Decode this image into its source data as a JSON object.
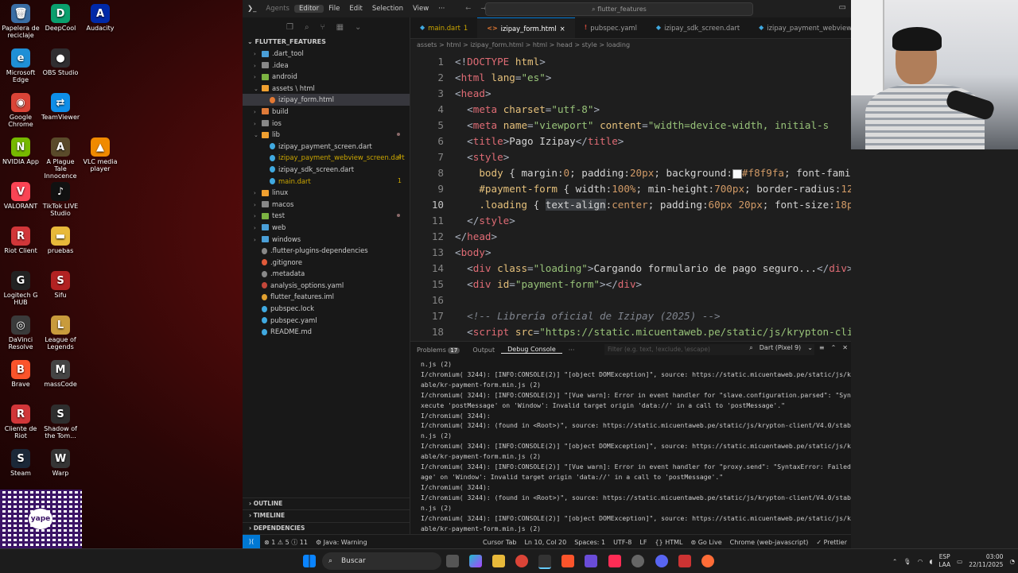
{
  "desktop": {
    "icons": [
      {
        "label": "Papelera de reciclaje",
        "glyph": "🗑",
        "color": "#3a6ea5"
      },
      {
        "label": "Microsoft Edge",
        "glyph": "e",
        "color": "#1f8fd6"
      },
      {
        "label": "Google Chrome",
        "glyph": "◉",
        "color": "#db4437"
      },
      {
        "label": "NVIDIA App",
        "glyph": "N",
        "color": "#76b900"
      },
      {
        "label": "VALORANT",
        "glyph": "V",
        "color": "#fa4454"
      },
      {
        "label": "Riot Client",
        "glyph": "R",
        "color": "#d13639"
      },
      {
        "label": "Logitech G HUB",
        "glyph": "G",
        "color": "#222222"
      },
      {
        "label": "DaVinci Resolve",
        "glyph": "◎",
        "color": "#3a3a3a"
      },
      {
        "label": "Brave",
        "glyph": "B",
        "color": "#fb542b"
      },
      {
        "label": "Cliente de Riot",
        "glyph": "R",
        "color": "#d13639"
      },
      {
        "label": "Steam",
        "glyph": "S",
        "color": "#1b2838"
      },
      {
        "label": "DeepCool",
        "glyph": "D",
        "color": "#0aa06e"
      },
      {
        "label": "OBS Studio",
        "glyph": "●",
        "color": "#302e31"
      },
      {
        "label": "TeamViewer",
        "glyph": "⇄",
        "color": "#0e8ee9"
      },
      {
        "label": "A Plague Tale Innocence",
        "glyph": "A",
        "color": "#5a4a2a"
      },
      {
        "label": "TikTok LIVE Studio",
        "glyph": "♪",
        "color": "#111111"
      },
      {
        "label": "pruebas",
        "glyph": "▬",
        "color": "#e8b93a"
      },
      {
        "label": "Sifu",
        "glyph": "S",
        "color": "#b22222"
      },
      {
        "label": "League of Legends",
        "glyph": "L",
        "color": "#c89b3c"
      },
      {
        "label": "massCode",
        "glyph": "M",
        "color": "#444444"
      },
      {
        "label": "Shadow of the Tom...",
        "glyph": "S",
        "color": "#2e2e2e"
      },
      {
        "label": "Warp",
        "glyph": "W",
        "color": "#353535"
      },
      {
        "label": "Audacity",
        "glyph": "A",
        "color": "#0029a8"
      },
      {
        "label": "VLC media player",
        "glyph": "▲",
        "color": "#f08a00"
      }
    ],
    "qr_label": "yape"
  },
  "titlebar": {
    "items": [
      "Agents",
      "Editor",
      "File",
      "Edit",
      "Selection",
      "View",
      "···"
    ],
    "search": "flutter_features"
  },
  "sidebar": {
    "title": "FLUTTER_FEATURES",
    "tree": [
      {
        "label": ".dart_tool",
        "depth": 1,
        "folder": true,
        "open": false,
        "color": "#4a9fd8"
      },
      {
        "label": ".idea",
        "depth": 1,
        "folder": true,
        "open": false,
        "color": "#888888"
      },
      {
        "label": "android",
        "depth": 1,
        "folder": true,
        "open": false,
        "color": "#7cb342"
      },
      {
        "label": "assets \\ html",
        "depth": 1,
        "folder": true,
        "open": true,
        "color": "#f0a030"
      },
      {
        "label": "izipay_form.html",
        "depth": 2,
        "folder": false,
        "color": "#e37933",
        "selected": true
      },
      {
        "label": "build",
        "depth": 1,
        "folder": true,
        "open": false,
        "color": "#e07b39"
      },
      {
        "label": "ios",
        "depth": 1,
        "folder": true,
        "open": false,
        "color": "#888888"
      },
      {
        "label": "lib",
        "depth": 1,
        "folder": true,
        "open": true,
        "color": "#f0a030",
        "mod": true
      },
      {
        "label": "izipay_payment_screen.dart",
        "depth": 2,
        "folder": false,
        "color": "#40a9e0"
      },
      {
        "label": "izipay_payment_webview_screen.dart",
        "depth": 2,
        "folder": false,
        "color": "#40a9e0",
        "badge": "4",
        "badgeColor": "#cca700"
      },
      {
        "label": "izipay_sdk_screen.dart",
        "depth": 2,
        "folder": false,
        "color": "#40a9e0"
      },
      {
        "label": "main.dart",
        "depth": 2,
        "folder": false,
        "color": "#40a9e0",
        "badge": "1",
        "badgeColor": "#cca700"
      },
      {
        "label": "linux",
        "depth": 1,
        "folder": true,
        "open": false,
        "color": "#f0a030"
      },
      {
        "label": "macos",
        "depth": 1,
        "folder": true,
        "open": false,
        "color": "#888888"
      },
      {
        "label": "test",
        "depth": 1,
        "folder": true,
        "open": false,
        "color": "#7cb342",
        "mod": true
      },
      {
        "label": "web",
        "depth": 1,
        "folder": true,
        "open": false,
        "color": "#4a9fd8"
      },
      {
        "label": "windows",
        "depth": 1,
        "folder": true,
        "open": false,
        "color": "#4a9fd8"
      },
      {
        "label": ".flutter-plugins-dependencies",
        "depth": 1,
        "folder": false,
        "color": "#888888"
      },
      {
        "label": ".gitignore",
        "depth": 1,
        "folder": false,
        "color": "#e05a3a"
      },
      {
        "label": ".metadata",
        "depth": 1,
        "folder": false,
        "color": "#888888"
      },
      {
        "label": "analysis_options.yaml",
        "depth": 1,
        "folder": false,
        "color": "#c4473a"
      },
      {
        "label": "flutter_features.iml",
        "depth": 1,
        "folder": false,
        "color": "#e0a030"
      },
      {
        "label": "pubspec.lock",
        "depth": 1,
        "folder": false,
        "color": "#40a9e0"
      },
      {
        "label": "pubspec.yaml",
        "depth": 1,
        "folder": false,
        "color": "#40a9e0"
      },
      {
        "label": "README.md",
        "depth": 1,
        "folder": false,
        "color": "#40a9e0"
      }
    ],
    "sections": [
      "OUTLINE",
      "TIMELINE",
      "DEPENDENCIES"
    ]
  },
  "tabs": [
    {
      "label": "main.dart",
      "suffix": "1",
      "icon": "◆",
      "iconColor": "#40a9e0",
      "active": false
    },
    {
      "label": "izipay_form.html",
      "suffix": "×",
      "icon": "<>",
      "iconColor": "#e37933",
      "active": true
    },
    {
      "label": "pubspec.yaml",
      "suffix": "",
      "icon": "!",
      "iconColor": "#c4473a",
      "active": false
    },
    {
      "label": "izipay_sdk_screen.dart",
      "suffix": "",
      "icon": "◆",
      "iconColor": "#40a9e0",
      "active": false
    },
    {
      "label": "izipay_payment_webview_scre",
      "suffix": "",
      "icon": "◆",
      "iconColor": "#40a9e0",
      "active": false
    }
  ],
  "breadcrumb": "assets > html > izipay_form.html > html > head > style > loading",
  "code": [
    "<span class='t-pun'>&lt;!</span><span class='t-tag'>DOCTYPE</span> <span class='t-attr'>html</span><span class='t-pun'>&gt;</span>",
    "<span class='t-pun'>&lt;</span><span class='t-tag'>html</span> <span class='t-attr'>lang</span><span class='t-pun'>=</span><span class='t-str'>\"es\"</span><span class='t-pun'>&gt;</span>",
    "<span class='t-pun'>&lt;</span><span class='t-tag'>head</span><span class='t-pun'>&gt;</span>",
    "  <span class='t-pun'>&lt;</span><span class='t-tag'>meta</span> <span class='t-attr'>charset</span><span class='t-pun'>=</span><span class='t-str'>\"utf-8\"</span><span class='t-pun'>&gt;</span>",
    "  <span class='t-pun'>&lt;</span><span class='t-tag'>meta</span> <span class='t-attr'>name</span><span class='t-pun'>=</span><span class='t-str'>\"viewport\"</span> <span class='t-attr'>content</span><span class='t-pun'>=</span><span class='t-str'>\"width=device-width, initial-s</span>",
    "  <span class='t-pun'>&lt;</span><span class='t-tag'>title</span><span class='t-pun'>&gt;</span><span class='t-txt'>Pago Izipay</span><span class='t-pun'>&lt;/</span><span class='t-tag'>title</span><span class='t-pun'>&gt;</span>",
    "  <span class='t-pun'>&lt;</span><span class='t-tag'>style</span><span class='t-pun'>&gt;</span>",
    "    <span class='t-sel'>body</span> { <span class='t-prop'>margin</span>:<span class='t-val'>0</span>; <span class='t-prop'>padding</span>:<span class='t-val'>20px</span>; <span class='t-prop'>background</span>:<span style='background:#f8f9fa;display:inline-block;width:10px;height:10px;border:1px solid #888;vertical-align:middle'></span><span class='t-val'>#f8f9fa</span>; <span class='t-prop'>font-family</span>:<span class='t-val'>system-ui,</span>",
    "    <span class='t-sel'>#payment-form</span> { <span class='t-prop'>width</span>:<span class='t-val'>100%</span>; <span class='t-prop'>min-height</span>:<span class='t-val'>700px</span>; <span class='t-prop'>border-radius</span>:<span class='t-val'>12px</span>; <span class='t-prop'>overflow</span>:<span class='t-val'>h</span>",
    "    <span class='t-sel'>.loading</span> { <span class='t-prop' style='background:#3a3d41'>text-align</span>:<span class='t-val'>center</span>; <span class='t-prop'>padding</span>:<span class='t-val'>60px 20px</span>; <span class='t-prop'>font-size</span>:<span class='t-val'>18px</span>; <span class='t-prop'>color</span>:<span style='background:#333;display:inline-block;width:10px;height:10px;border:1px solid #888;vertical-align:middle'></span><span class='t-val'>#33</span>",
    "  <span class='t-pun'>&lt;/</span><span class='t-tag'>style</span><span class='t-pun'>&gt;</span>",
    "<span class='t-pun'>&lt;/</span><span class='t-tag'>head</span><span class='t-pun'>&gt;</span>",
    "<span class='t-pun'>&lt;</span><span class='t-tag'>body</span><span class='t-pun'>&gt;</span>",
    "  <span class='t-pun'>&lt;</span><span class='t-tag'>div</span> <span class='t-attr'>class</span><span class='t-pun'>=</span><span class='t-str'>\"loading\"</span><span class='t-pun'>&gt;</span><span class='t-txt'>Cargando formulario de pago seguro...</span><span class='t-pun'>&lt;/</span><span class='t-tag'>div</span><span class='t-pun'>&gt;</span>",
    "  <span class='t-pun'>&lt;</span><span class='t-tag'>div</span> <span class='t-attr'>id</span><span class='t-pun'>=</span><span class='t-str'>\"payment-form\"</span><span class='t-pun'>&gt;&lt;/</span><span class='t-tag'>div</span><span class='t-pun'>&gt;</span>",
    "",
    "  <span class='t-com'>&lt;!-- Librería oficial de Izipay (2025) --&gt;</span>",
    "  <span class='t-pun'>&lt;</span><span class='t-tag'>script</span> <span class='t-attr'>src</span><span class='t-pun'>=</span><span class='t-str'>\"https://static.micuentaweb.pe/static/js/krypton-client/V4.0/stabl</span>"
  ],
  "current_line": 10,
  "panel": {
    "tabs": [
      "Problems",
      "Output",
      "Debug Console",
      "···"
    ],
    "problems_count": "17",
    "filter_placeholder": "Filter (e.g. text, !exclude, \\escape)",
    "device": "Dart (Pixel 9)",
    "console": [
      "n.js (2)",
      "I/chromium( 3244): [INFO:CONSOLE(2)] \"[object DOMException]\", source: https://static.micuentaweb.pe/static/js/krypton-client/V4.0/st",
      "able/kr-payment-form.min.js (2)",
      "I/chromium( 3244): [INFO:CONSOLE(2)] \"[Vue warn]: Error in event handler for \"slave.configuration.parsed\": \"SyntaxError: Failed to e",
      "xecute 'postMessage' on 'Window': Invalid target origin 'data://' in a call to 'postMessage'.\"",
      "I/chromium( 3244):",
      "I/chromium( 3244): (found in <Root>)\", source: https://static.micuentaweb.pe/static/js/krypton-client/V4.0/stable/kr-payment-form.mi",
      "n.js (2)",
      "I/chromium( 3244): [INFO:CONSOLE(2)] \"[object DOMException]\", source: https://static.micuentaweb.pe/static/js/krypton-client/V4.0/st",
      "able/kr-payment-form.min.js (2)",
      "I/chromium( 3244): [INFO:CONSOLE(2)] \"[Vue warn]: Error in event handler for \"proxy.send\": \"SyntaxError: Failed to execute 'postMess",
      "age' on 'Window': Invalid target origin 'data://' in a call to 'postMessage'.\"",
      "I/chromium( 3244):",
      "I/chromium( 3244): (found in <Root>)\", source: https://static.micuentaweb.pe/static/js/krypton-client/V4.0/stable/kr-payment-form.mi",
      "n.js (2)",
      "I/chromium( 3244): [INFO:CONSOLE(2)] \"[object DOMException]\", source: https://static.micuentaweb.pe/static/js/krypton-client/V4.0/st",
      "able/kr-payment-form.min.js (2)"
    ]
  },
  "status": {
    "left": [
      "⊗ 1 ⚠ 5 ⓘ 11",
      "⚙ Java: Warning"
    ],
    "right": [
      "Cursor Tab",
      "Ln 10, Col 20",
      "Spaces: 1",
      "UTF-8",
      "LF",
      "{} HTML",
      "⊚ Go Live",
      "Chrome (web-javascript)",
      "✓ Prettier"
    ]
  },
  "taskbar": {
    "search": "Buscar",
    "lang": "ESP",
    "lang2": "LAA",
    "time": "03:00",
    "date": "22/11/2025"
  }
}
